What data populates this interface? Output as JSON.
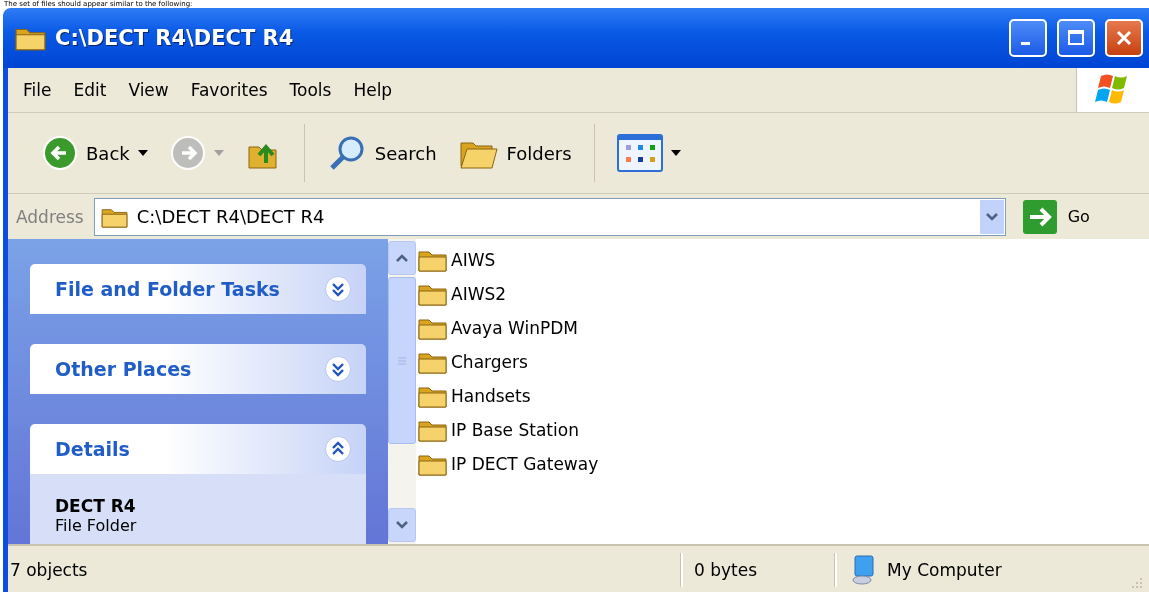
{
  "caption": "The set of files should appear similar to the following:",
  "window": {
    "title": "C:\\DECT R4\\DECT R4"
  },
  "menu": [
    "File",
    "Edit",
    "View",
    "Favorites",
    "Tools",
    "Help"
  ],
  "toolbar": [
    {
      "kind": "back",
      "label": "Back",
      "disabled": false
    },
    {
      "kind": "forward",
      "disabled": true
    },
    {
      "kind": "up",
      "disabled": false
    },
    {
      "kind": "search",
      "label": "Search",
      "disabled": false
    },
    {
      "kind": "folders",
      "label": "Folders",
      "disabled": false
    },
    {
      "kind": "views",
      "disabled": false
    }
  ],
  "address": {
    "label": "Address",
    "value": "C:\\DECT R4\\DECT R4",
    "go": "Go"
  },
  "sidebar": {
    "panels": [
      {
        "title": "File and Folder Tasks",
        "expanded": false
      },
      {
        "title": "Other Places",
        "expanded": false
      },
      {
        "title": "Details",
        "expanded": true,
        "name": "DECT R4",
        "type": "File Folder"
      }
    ]
  },
  "files": [
    "AIWS",
    "AIWS2",
    "Avaya WinPDM",
    "Chargers",
    "Handsets",
    "IP Base Station",
    "IP DECT Gateway"
  ],
  "status_bar": {
    "objects": "7 objects",
    "size": "0 bytes",
    "zone": "My Computer"
  }
}
